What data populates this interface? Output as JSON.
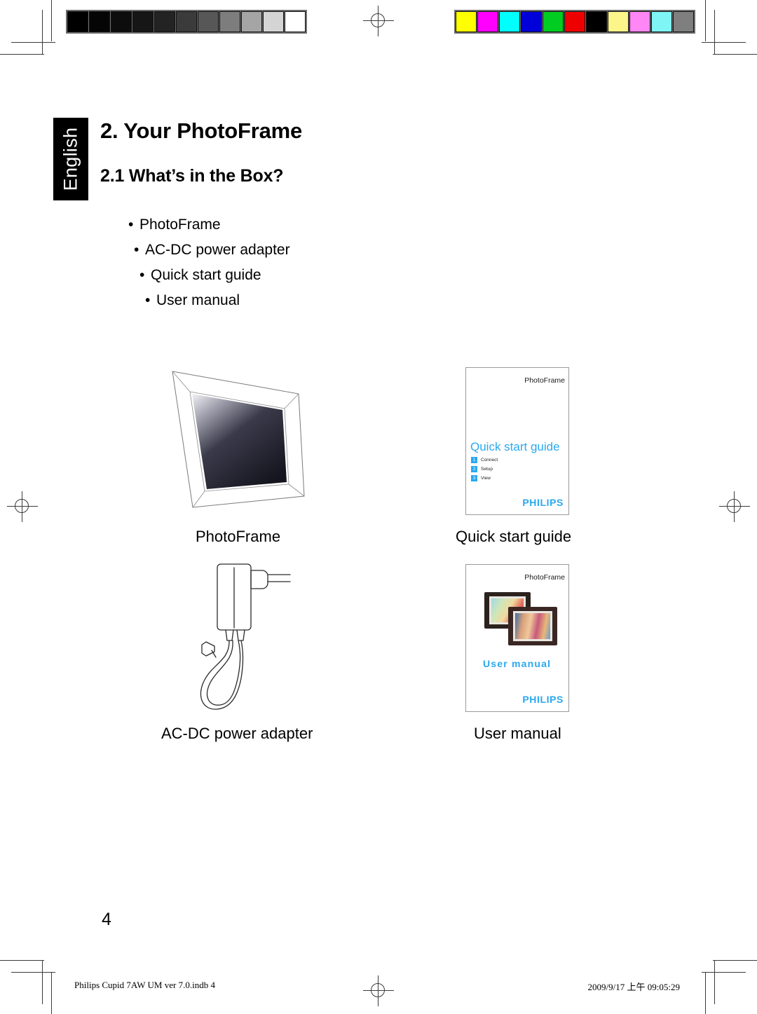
{
  "page": {
    "language_tab": "English",
    "chapter_title": "2. Your PhotoFrame",
    "section_title": "2.1 What’s in the Box?",
    "page_number": "4"
  },
  "box_contents": {
    "bullet_char": "•",
    "items": [
      "PhotoFrame",
      "AC-DC power adapter",
      "Quick start guide",
      "User manual"
    ]
  },
  "figures": [
    {
      "caption": "PhotoFrame",
      "icon": "photoframe-illustration"
    },
    {
      "caption": "Quick start guide",
      "icon": "quick-start-guide-booklet"
    },
    {
      "caption": "AC-DC power adapter",
      "icon": "ac-dc-adapter-illustration"
    },
    {
      "caption": "User manual",
      "icon": "user-manual-booklet"
    }
  ],
  "quick_start_booklet": {
    "brand": "PhotoFrame",
    "title": "Quick start guide",
    "steps": [
      {
        "number": "1",
        "label": "Connect"
      },
      {
        "number": "2",
        "label": "Setup"
      },
      {
        "number": "3",
        "label": "View"
      }
    ],
    "logo": "PHILIPS"
  },
  "user_manual_booklet": {
    "brand": "PhotoFrame",
    "title": "User manual",
    "logo": "PHILIPS"
  },
  "footer": {
    "left": "Philips Cupid 7AW UM ver 7.0.indb   4",
    "right": "2009/9/17   上午 09:05:29"
  },
  "calibration": {
    "grayscale_patches": [
      "#000000",
      "#050505",
      "#0d0d0d",
      "#161616",
      "#232323",
      "#3b3b3b",
      "#575757",
      "#7d7d7d",
      "#a5a5a5",
      "#d4d4d4",
      "#ffffff"
    ],
    "color_patches": [
      "#ffff00",
      "#ff00ff",
      "#00ffff",
      "#0000d8",
      "#00cc22",
      "#ee0000",
      "#000000",
      "#fcf58a",
      "#ff86f5",
      "#7ff5f5",
      "#7f7f7f"
    ]
  },
  "colors": {
    "philips_blue": "#2aa8ef",
    "tab_background": "#000000",
    "mark_gray": "#3a3a3a"
  }
}
